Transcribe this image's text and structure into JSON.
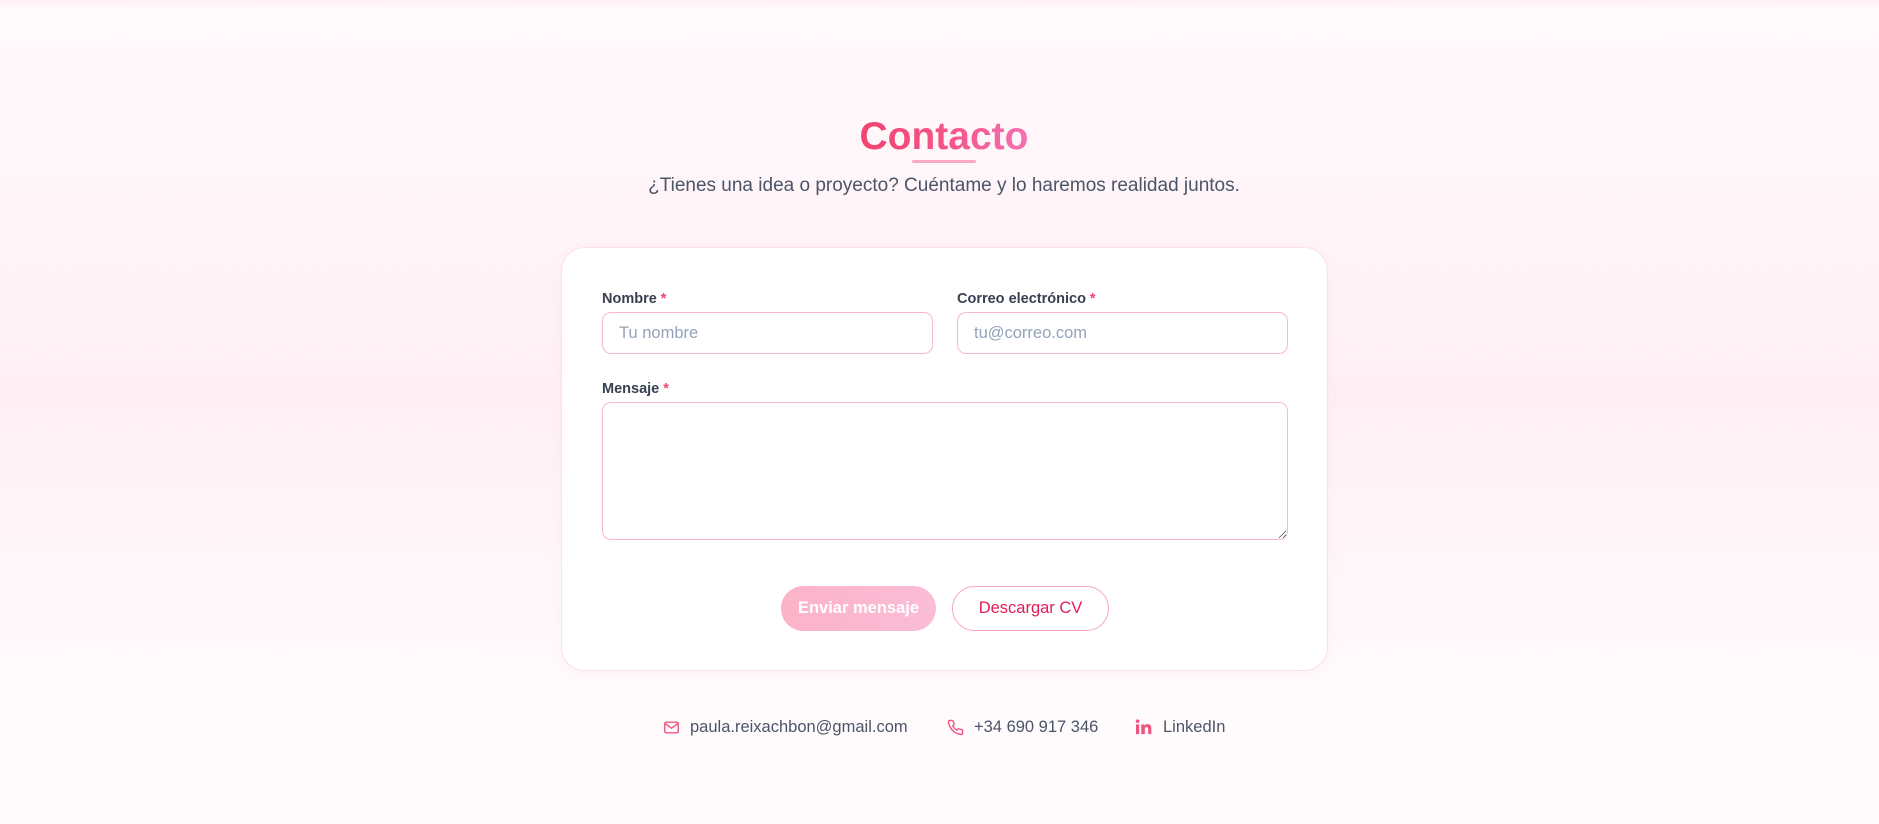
{
  "section": {
    "title": "Contacto",
    "subtitle": "¿Tienes una idea o proyecto? Cuéntame y lo haremos realidad juntos."
  },
  "form": {
    "name": {
      "label": "Nombre",
      "required_mark": "*",
      "placeholder": "Tu nombre",
      "value": ""
    },
    "email": {
      "label": "Correo electrónico",
      "required_mark": "*",
      "placeholder": "tu@correo.com",
      "value": ""
    },
    "message": {
      "label": "Mensaje",
      "required_mark": "*",
      "placeholder": "",
      "value": ""
    },
    "submit_label": "Enviar mensaje",
    "cv_label": "Descargar CV"
  },
  "contact_links": [
    {
      "icon": "mail-icon",
      "text": "paula.reixachbon@gmail.com"
    },
    {
      "icon": "phone-icon",
      "text": "+34 690 917 346"
    },
    {
      "icon": "linkedin-icon",
      "text": "LinkedIn"
    }
  ],
  "colors": {
    "accent": "#ef4470",
    "accent_light": "#f9a8c4",
    "text": "#4b5568",
    "background": "#fff0f5"
  }
}
